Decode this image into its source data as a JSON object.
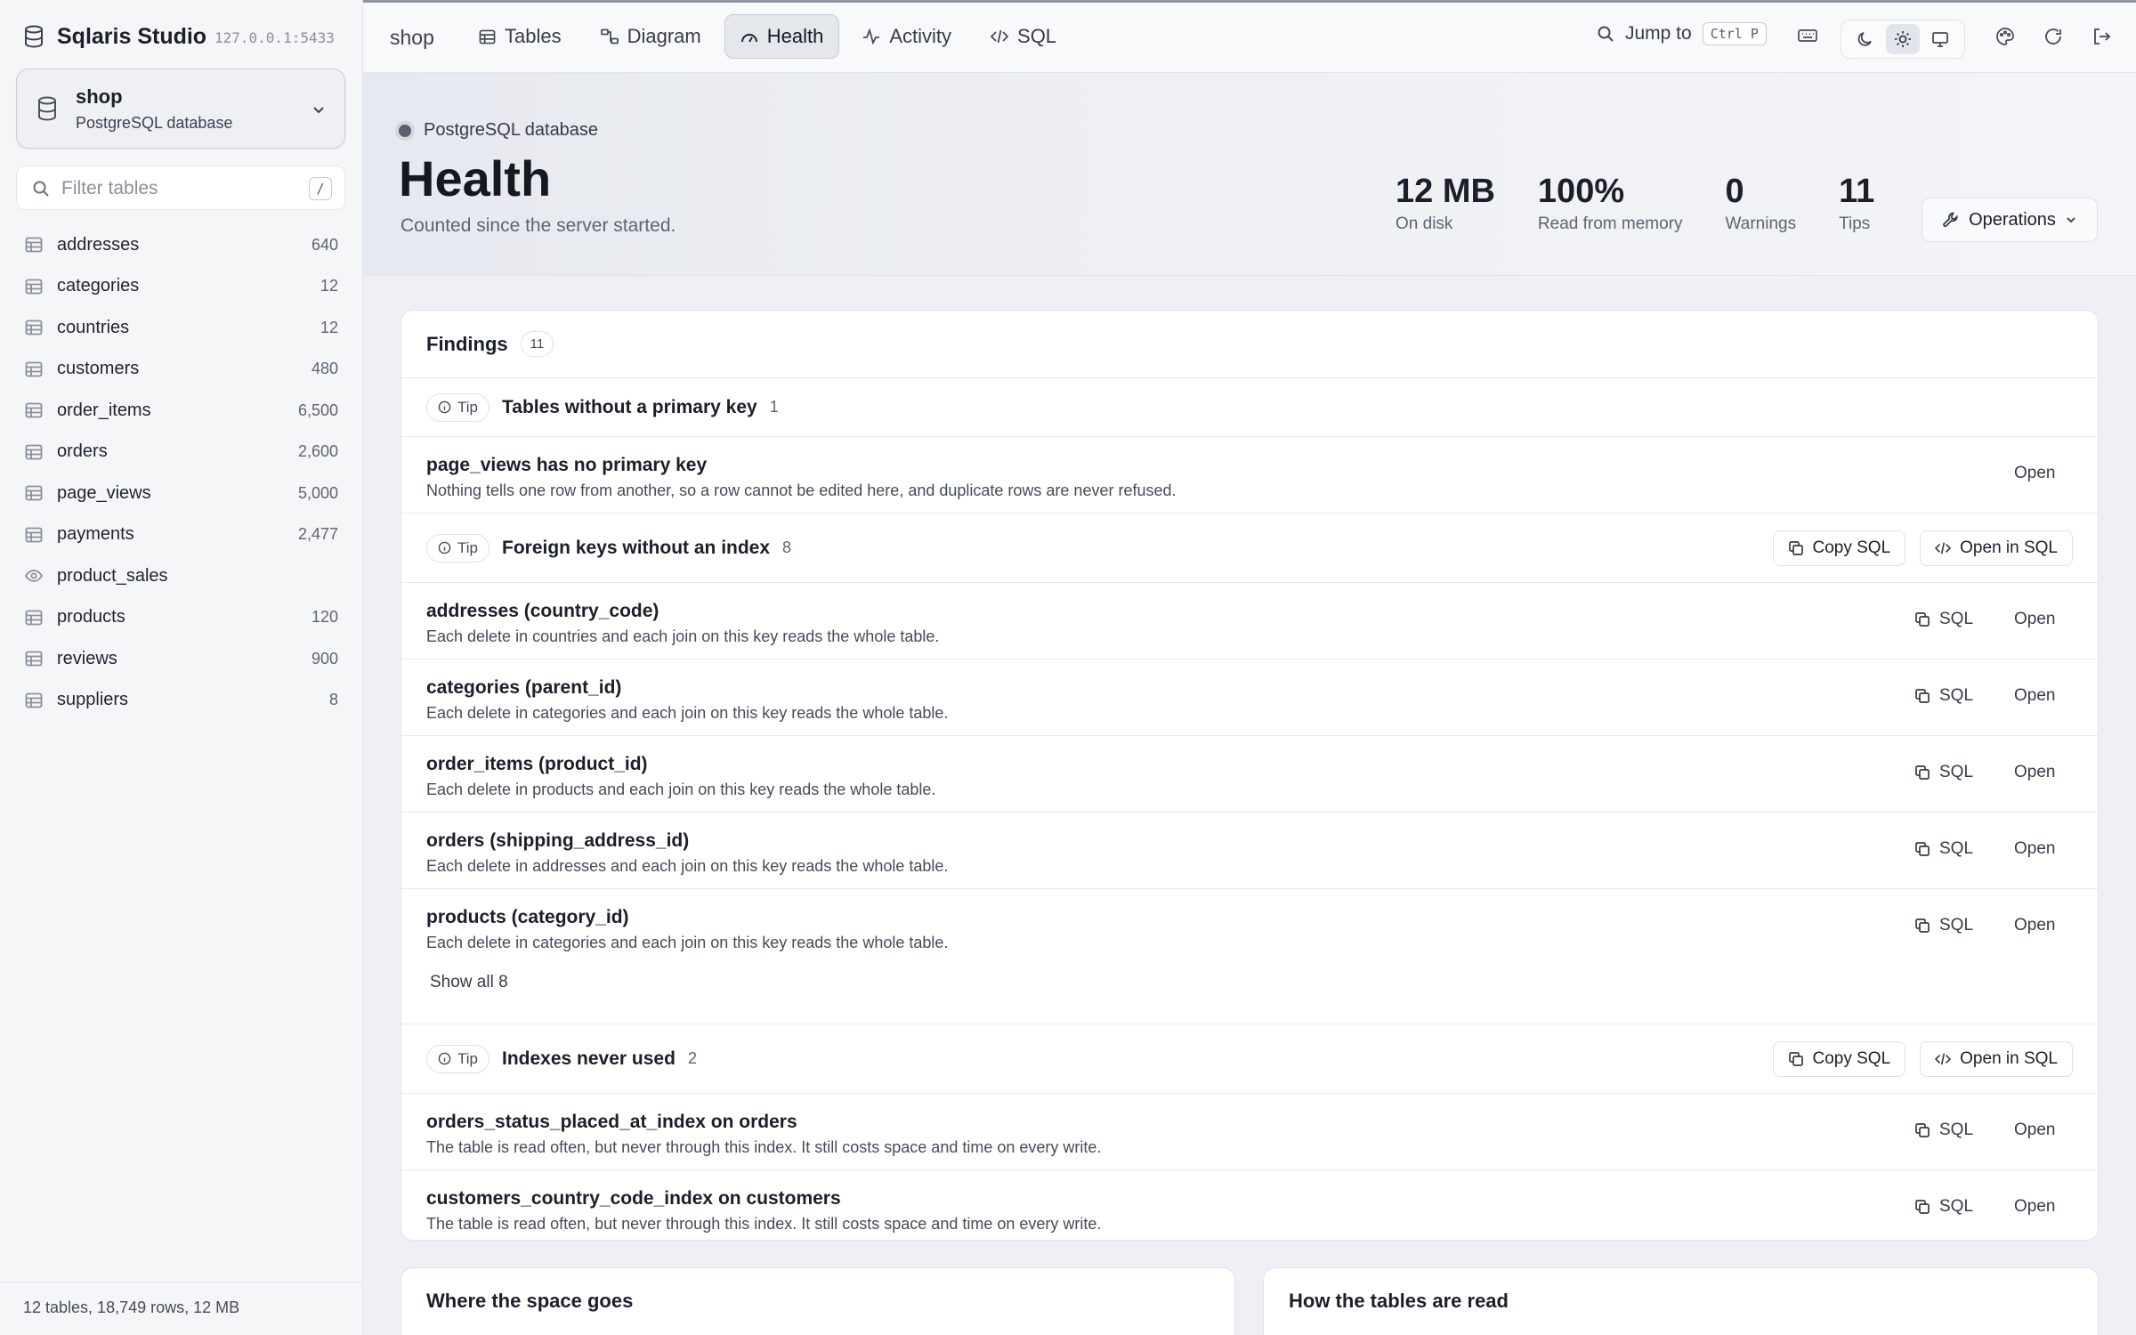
{
  "app": {
    "name": "Sqlaris Studio",
    "host": "127.0.0.1:5433"
  },
  "database": {
    "name": "shop",
    "kind": "PostgreSQL database"
  },
  "filter": {
    "placeholder": "Filter tables",
    "shortcut": "/"
  },
  "tables": [
    {
      "name": "addresses",
      "count": "640",
      "icon": "table-icon"
    },
    {
      "name": "categories",
      "count": "12",
      "icon": "table-icon"
    },
    {
      "name": "countries",
      "count": "12",
      "icon": "table-icon"
    },
    {
      "name": "customers",
      "count": "480",
      "icon": "table-icon"
    },
    {
      "name": "order_items",
      "count": "6,500",
      "icon": "table-icon"
    },
    {
      "name": "orders",
      "count": "2,600",
      "icon": "table-icon"
    },
    {
      "name": "page_views",
      "count": "5,000",
      "icon": "table-icon"
    },
    {
      "name": "payments",
      "count": "2,477",
      "icon": "table-icon"
    },
    {
      "name": "product_sales",
      "count": "",
      "icon": "eye-icon"
    },
    {
      "name": "products",
      "count": "120",
      "icon": "table-icon"
    },
    {
      "name": "reviews",
      "count": "900",
      "icon": "table-icon"
    },
    {
      "name": "suppliers",
      "count": "8",
      "icon": "table-icon"
    }
  ],
  "sidebar_footer": "12 tables, 18,749 rows, 12 MB",
  "topbar": {
    "crumb": "shop",
    "tabs": [
      {
        "label": "Tables",
        "icon": "table-icon",
        "active": false
      },
      {
        "label": "Diagram",
        "icon": "diagram-icon",
        "active": false
      },
      {
        "label": "Health",
        "icon": "gauge-icon",
        "active": true
      },
      {
        "label": "Activity",
        "icon": "activity-icon",
        "active": false
      },
      {
        "label": "SQL",
        "icon": "code-icon",
        "active": false
      }
    ],
    "jump_label": "Jump to",
    "jump_shortcut": "Ctrl P"
  },
  "hero": {
    "kicker": "PostgreSQL database",
    "title": "Health",
    "subtitle": "Counted since the server started.",
    "stats": [
      {
        "value": "12 MB",
        "label": "On disk"
      },
      {
        "value": "100%",
        "label": "Read from memory"
      },
      {
        "value": "0",
        "label": "Warnings"
      },
      {
        "value": "11",
        "label": "Tips"
      }
    ],
    "operations_label": "Operations"
  },
  "findings": {
    "title": "Findings",
    "count": "11",
    "tip_label": "Tip",
    "copy_sql_label": "Copy SQL",
    "open_in_sql_label": "Open in SQL",
    "sql_label": "SQL",
    "open_label": "Open",
    "show_all_label": "Show all 8",
    "groups": [
      {
        "title": "Tables without a primary key",
        "count": "1",
        "rows": [
          {
            "title": "page_views has no primary key",
            "desc": "Nothing tells one row from another, so a row cannot be edited here, and duplicate rows are never refused."
          }
        ]
      },
      {
        "title": "Foreign keys without an index",
        "count": "8",
        "rows": [
          {
            "title": "addresses (country_code)",
            "desc": "Each delete in countries and each join on this key reads the whole table."
          },
          {
            "title": "categories (parent_id)",
            "desc": "Each delete in categories and each join on this key reads the whole table."
          },
          {
            "title": "order_items (product_id)",
            "desc": "Each delete in products and each join on this key reads the whole table."
          },
          {
            "title": "orders (shipping_address_id)",
            "desc": "Each delete in addresses and each join on this key reads the whole table."
          },
          {
            "title": "products (category_id)",
            "desc": "Each delete in categories and each join on this key reads the whole table."
          }
        ]
      },
      {
        "title": "Indexes never used",
        "count": "2",
        "rows": [
          {
            "title": "orders_status_placed_at_index on orders",
            "desc": "The table is read often, but never through this index. It still costs space and time on every write."
          },
          {
            "title": "customers_country_code_index on customers",
            "desc": "The table is read often, but never through this index. It still costs space and time on every write."
          }
        ]
      }
    ]
  },
  "bottom_cards": {
    "space_title": "Where the space goes",
    "reads_title": "How the tables are read"
  }
}
